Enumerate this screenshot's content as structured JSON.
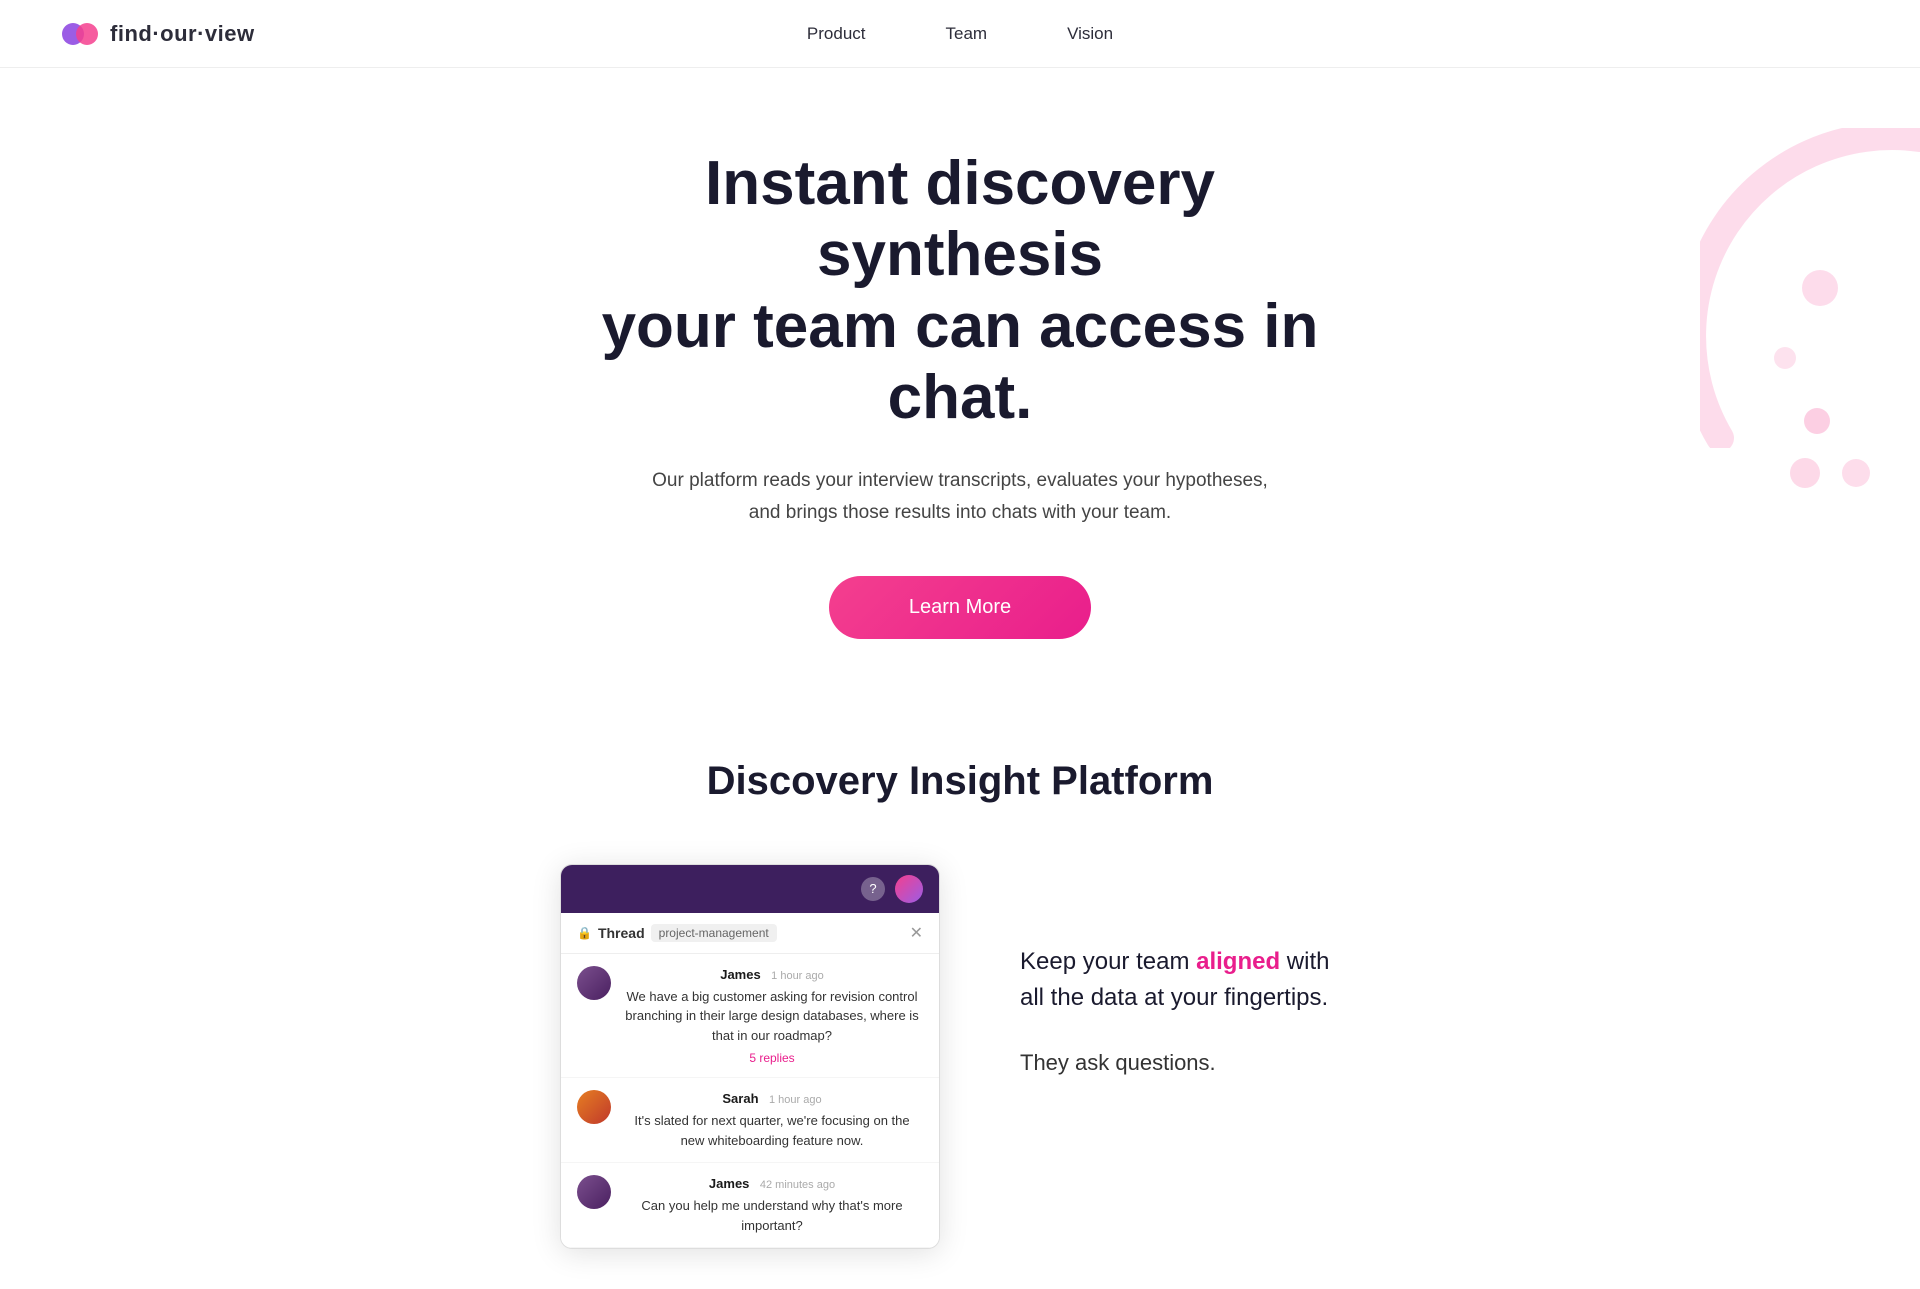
{
  "brand": {
    "logo_text": "find·our·view",
    "logo_symbol": "◉"
  },
  "nav": {
    "links": [
      {
        "label": "Product",
        "href": "#"
      },
      {
        "label": "Team",
        "href": "#"
      },
      {
        "label": "Vision",
        "href": "#"
      }
    ]
  },
  "hero": {
    "headline_line1": "Instant discovery synthesis",
    "headline_line2": "your team can access in chat.",
    "subtext": "Our platform reads your interview transcripts, evaluates your hypotheses, and brings those results into chats with your team.",
    "cta_label": "Learn More"
  },
  "section2": {
    "heading": "Discovery Insight Platform",
    "demo_text_p1_before": "Keep your team ",
    "demo_text_highlight": "aligned",
    "demo_text_p1_after": " with all the data at your fingertips.",
    "demo_text_p2": "They ask questions."
  },
  "chat_demo": {
    "thread_label": "Thread",
    "thread_channel": "project-management",
    "messages": [
      {
        "name": "James",
        "time": "1 hour ago",
        "text": "We have a big customer asking for revision control branching in their large design databases, where is that in our roadmap?",
        "replies": "5 replies",
        "avatar_class": "james"
      },
      {
        "name": "Sarah",
        "time": "1 hour ago",
        "text": "It's slated for next quarter, we're focusing on the new whiteboarding feature now.",
        "replies": "",
        "avatar_class": "sarah"
      },
      {
        "name": "James",
        "time": "42 minutes ago",
        "text": "Can you help me understand why that's more important?",
        "replies": "",
        "avatar_class": "james"
      }
    ]
  },
  "colors": {
    "accent": "#e91e8c",
    "brand_purple": "#3d1f5e",
    "dot_color": "rgba(244,63,142,0.22)"
  }
}
